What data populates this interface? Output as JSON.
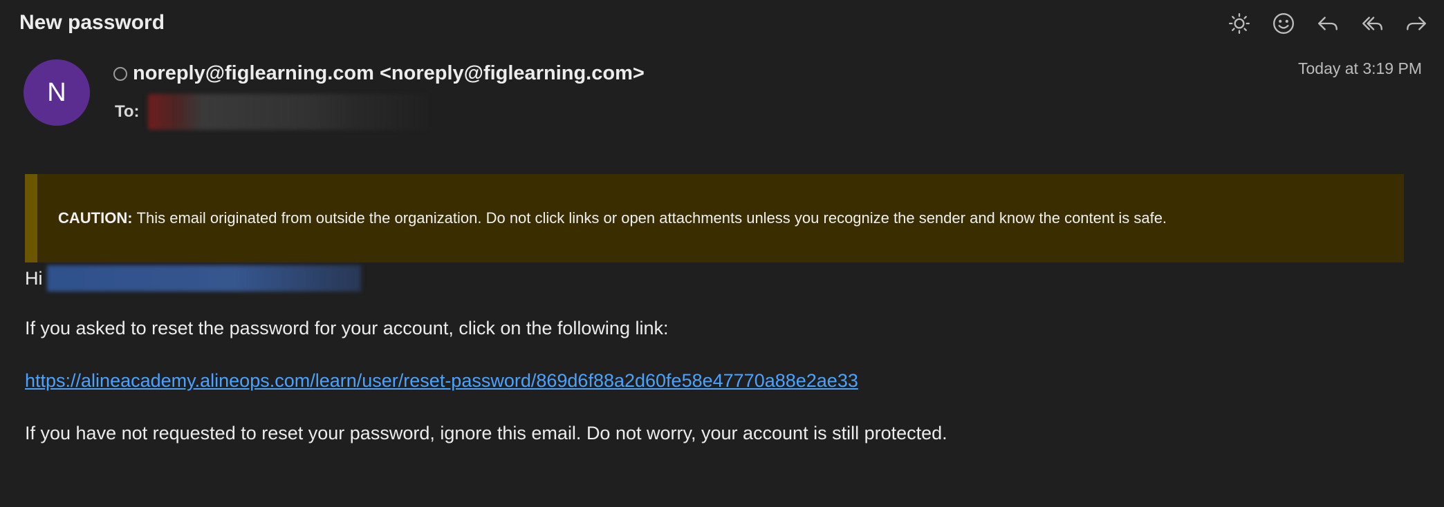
{
  "email": {
    "subject": "New password",
    "avatar_initial": "N",
    "from": "noreply@figlearning.com <noreply@figlearning.com>",
    "to_label": "To:",
    "timestamp": "Today at 3:19 PM",
    "caution_label": "CAUTION:",
    "caution_text": "This email originated from outside the organization. Do not click links or open attachments unless you recognize the sender and know the content is safe.",
    "greeting": "Hi",
    "body_line1": "If you asked to reset the password for your account, click on the following link:",
    "reset_link": "https://alineacademy.alineops.com/learn/user/reset-password/869d6f88a2d60fe58e47770a88e2ae33",
    "body_line2": "If you have not requested to reset your password, ignore this email. Do not worry, your account is still protected."
  },
  "toolbar": {
    "icons": [
      "sun-icon",
      "smiley-icon",
      "reply-icon",
      "reply-all-icon",
      "forward-icon"
    ]
  },
  "colors": {
    "background": "#1f1f1f",
    "avatar": "#5b2d91",
    "caution_bg": "#3a2d00",
    "caution_bar": "#6b5600",
    "link": "#4aa3ff"
  }
}
